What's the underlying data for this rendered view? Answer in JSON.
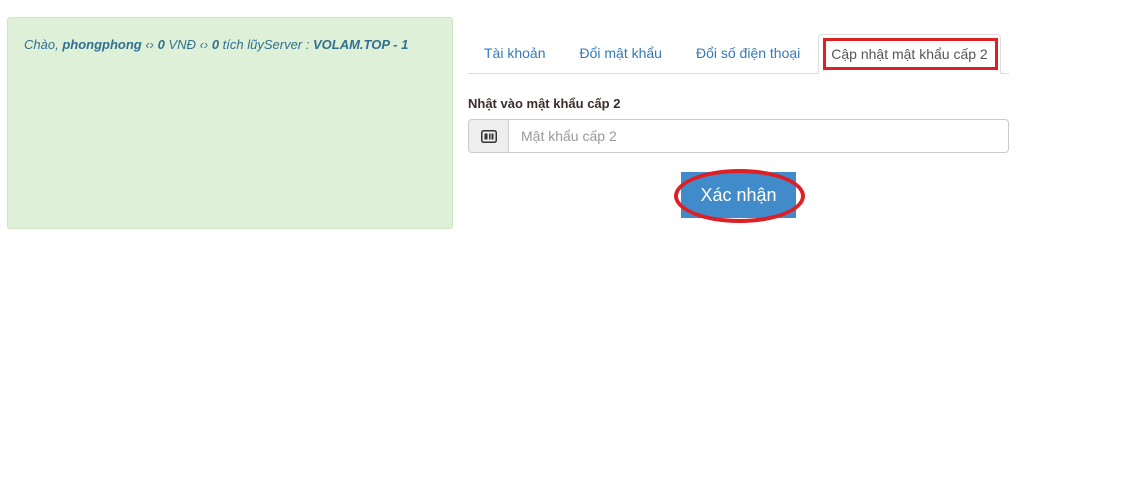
{
  "info": {
    "greeting": "Chào, ",
    "username": "phongphong",
    "sep1": " ‹› ",
    "vnd_amount": "0",
    "vnd_label": " VNĐ ‹› ",
    "points_amount": "0",
    "points_label": " tích lũyServer : ",
    "server": "VOLAM.TOP - 1"
  },
  "tabs": [
    {
      "label": "Tài khoản",
      "active": false
    },
    {
      "label": "Đổi mật khẩu",
      "active": false
    },
    {
      "label": "Đổi số điện thoại",
      "active": false
    },
    {
      "label": "Cập nhật mật khẩu cấp 2",
      "active": true
    }
  ],
  "form": {
    "label": "Nhật vào mật khẩu cấp 2",
    "placeholder": "Mật khẩu cấp 2",
    "value": "",
    "addon_icon": "keypad-icon",
    "submit_label": "Xác nhận"
  },
  "colors": {
    "info_bg": "#dff0d8",
    "info_text": "#31708f",
    "link": "#337ab7",
    "button": "#428bca",
    "highlight": "#dd1f26"
  }
}
